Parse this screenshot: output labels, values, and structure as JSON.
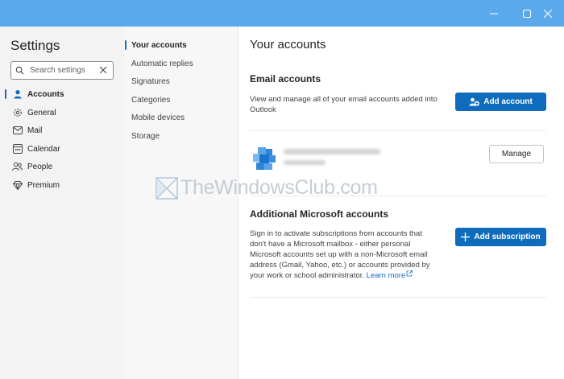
{
  "window": {
    "minimize_icon": "minimize-icon",
    "maximize_icon": "maximize-icon",
    "close_icon": "close-icon",
    "titlebar_color": "#5aa9ec"
  },
  "sidebar": {
    "title": "Settings",
    "search": {
      "placeholder": "Search settings"
    },
    "items": [
      {
        "label": "Accounts",
        "icon": "person-icon",
        "active": true
      },
      {
        "label": "General",
        "icon": "gear-icon",
        "active": false
      },
      {
        "label": "Mail",
        "icon": "mail-icon",
        "active": false
      },
      {
        "label": "Calendar",
        "icon": "calendar-icon",
        "active": false
      },
      {
        "label": "People",
        "icon": "people-icon",
        "active": false
      },
      {
        "label": "Premium",
        "icon": "diamond-icon",
        "active": false
      }
    ]
  },
  "subnav": {
    "items": [
      {
        "label": "Your accounts",
        "active": true
      },
      {
        "label": "Automatic replies",
        "active": false
      },
      {
        "label": "Signatures",
        "active": false
      },
      {
        "label": "Categories",
        "active": false
      },
      {
        "label": "Mobile devices",
        "active": false
      },
      {
        "label": "Storage",
        "active": false
      }
    ]
  },
  "main": {
    "title": "Your accounts",
    "email_accounts": {
      "heading": "Email accounts",
      "description": "View and manage all of your email accounts added into Outlook",
      "add_button": "Add account",
      "manage_button": "Manage"
    },
    "additional": {
      "heading": "Additional Microsoft accounts",
      "description": "Sign in to activate subscriptions from accounts that don't have a Microsoft mailbox - either personal Microsoft accounts set up with a non-Microsoft email address (Gmail, Yahoo, etc.) or accounts provided by your work or school administrator.",
      "learn_more": "Learn more",
      "add_button": "Add subscription"
    }
  },
  "watermark": {
    "text": "TheWindowsClub.com"
  },
  "colors": {
    "accent": "#0f6cbd"
  }
}
